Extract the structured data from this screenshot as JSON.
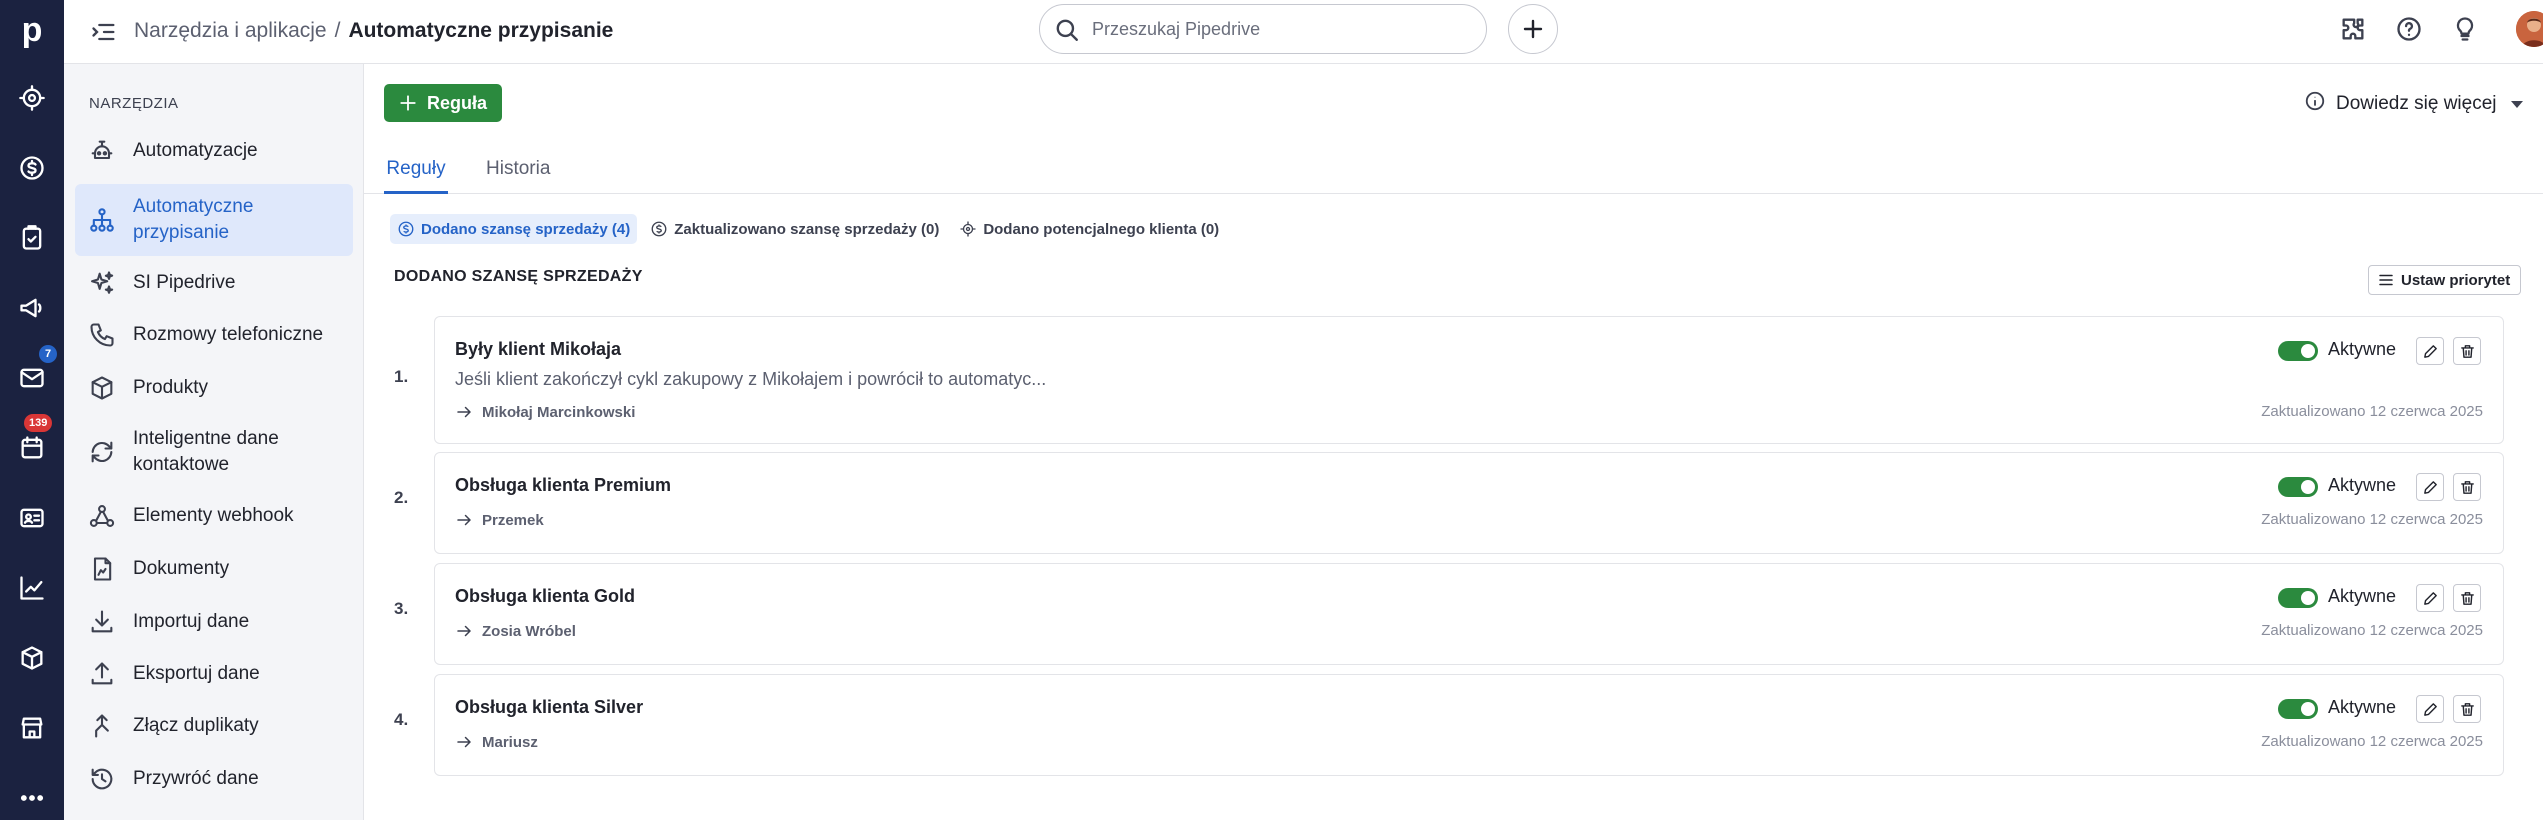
{
  "rail": {
    "logo": "p",
    "items": [
      {
        "name": "target-icon"
      },
      {
        "name": "dollar-icon"
      },
      {
        "name": "clipboard-check-icon"
      },
      {
        "name": "megaphone-icon"
      },
      {
        "name": "mail-icon",
        "badge": "7",
        "badge_color": "#2563c7"
      },
      {
        "name": "calendar-icon",
        "badge": "139",
        "badge_color": "#d93636"
      },
      {
        "name": "contact-card-icon"
      },
      {
        "name": "chart-icon"
      },
      {
        "name": "box-icon"
      },
      {
        "name": "store-icon"
      },
      {
        "name": "more-icon"
      }
    ]
  },
  "topbar": {
    "breadcrumb_parent": "Narzędzia i aplikacje",
    "breadcrumb_sep": "/",
    "breadcrumb_current": "Automatyczne przypisanie",
    "search_placeholder": "Przeszukaj Pipedrive"
  },
  "sidebar": {
    "title": "NARZĘDZIA",
    "items": [
      {
        "label": "Automatyzacje",
        "icon": "robot-icon"
      },
      {
        "label": "Automatyczne przypisanie",
        "icon": "hierarchy-icon",
        "active": true
      },
      {
        "label": "SI Pipedrive",
        "icon": "sparkle-icon"
      },
      {
        "label": "Rozmowy telefoniczne",
        "icon": "phone-icon"
      },
      {
        "label": "Produkty",
        "icon": "box-icon"
      },
      {
        "label": "Inteligentne dane kontaktowe",
        "icon": "refresh-icon"
      },
      {
        "label": "Elementy webhook",
        "icon": "webhook-icon"
      },
      {
        "label": "Dokumenty",
        "icon": "document-icon"
      },
      {
        "label": "Importuj dane",
        "icon": "import-icon"
      },
      {
        "label": "Eksportuj dane",
        "icon": "export-icon"
      },
      {
        "label": "Złącz duplikaty",
        "icon": "merge-icon"
      },
      {
        "label": "Przywróć dane",
        "icon": "restore-icon"
      }
    ]
  },
  "main": {
    "add_rule_label": "Reguła",
    "learn_more_label": "Dowiedz się więcej",
    "tabs": [
      {
        "label": "Reguły",
        "active": true
      },
      {
        "label": "Historia"
      }
    ],
    "filters": [
      {
        "label": "Dodano szansę sprzedaży (4)",
        "icon": "dollar-icon",
        "active": true
      },
      {
        "label": "Zaktualizowano szansę sprzedaży (0)",
        "icon": "dollar-icon"
      },
      {
        "label": "Dodano potencjalnego klienta (0)",
        "icon": "target-icon"
      }
    ],
    "section_title": "DODANO SZANSĘ SPRZEDAŻY",
    "priority_label": "Ustaw priorytet",
    "rules": [
      {
        "number": "1.",
        "name": "Były klient Mikołaja",
        "description": "Jeśli klient zakończył cykl zakupowy z Mikołajem i powrócił to automatyc...",
        "owner": "Mikołaj Marcinkowski",
        "status": "Aktywne",
        "active": true,
        "updated": "Zaktualizowano 12 czerwca 2025"
      },
      {
        "number": "2.",
        "name": "Obsługa klienta Premium",
        "description": "",
        "owner": "Przemek",
        "status": "Aktywne",
        "active": true,
        "updated": "Zaktualizowano 12 czerwca 2025"
      },
      {
        "number": "3.",
        "name": "Obsługa klienta Gold",
        "description": "",
        "owner": "Zosia Wróbel",
        "status": "Aktywne",
        "active": true,
        "updated": "Zaktualizowano 12 czerwca 2025"
      },
      {
        "number": "4.",
        "name": "Obsługa klienta Silver",
        "description": "",
        "owner": "Mariusz",
        "status": "Aktywne",
        "active": true,
        "updated": "Zaktualizowano 12 czerwca 2025"
      }
    ]
  },
  "colors": {
    "rail": "#1b2240",
    "accent": "#2563c7",
    "success": "#2b8a3e",
    "sidebar_bg": "#f4f5f8"
  }
}
